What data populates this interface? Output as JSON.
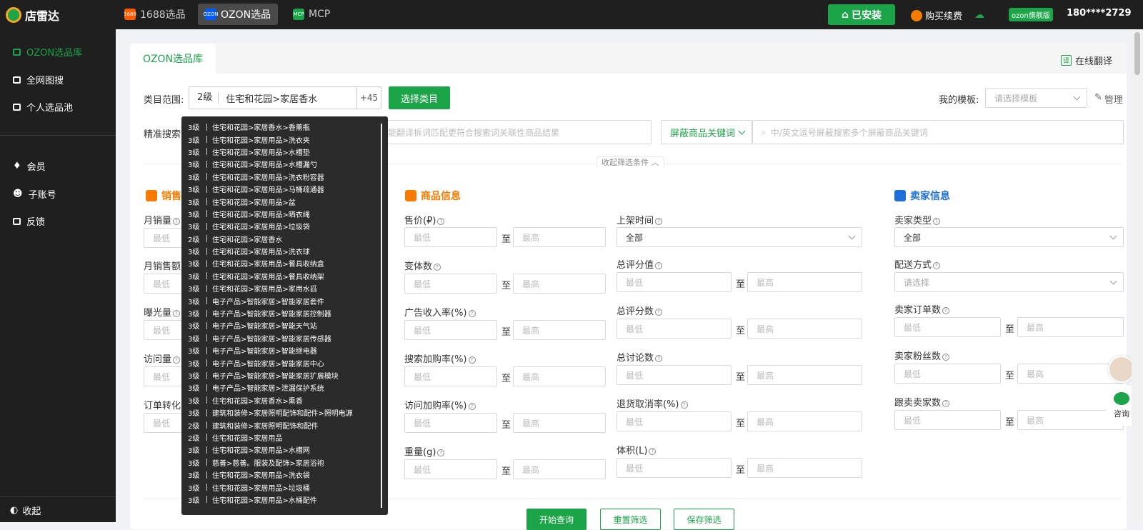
{
  "topbar": {
    "logo": "店雷达",
    "tabs": [
      {
        "label": "1688选品",
        "icon": "1688-icon",
        "color": "#ff5a00"
      },
      {
        "label": "OZON选品",
        "icon": "ozon-icon",
        "color": "#005bff"
      },
      {
        "label": "MCP",
        "icon": "mcp-icon",
        "color": "#1ba448"
      }
    ],
    "installed": "已安装",
    "renew": "购买续费",
    "vip": "ozon旗舰版",
    "phone": "180****2729"
  },
  "sidebar": {
    "items": [
      "OZON选品库",
      "全网图搜",
      "个人选品池"
    ],
    "items2": [
      "会员",
      "子账号",
      "反馈"
    ],
    "collapse": "收起"
  },
  "card": {
    "tab": "OZON选品库",
    "translate": "在线翻译",
    "category_label": "类目范围:",
    "category_level": "2级",
    "category_path": "住宅和花园>家居香水",
    "category_more": "+45",
    "select_category": "选择类目",
    "template_label": "我的模板:",
    "template_placeholder": "请选择模板",
    "manage": "管理",
    "precise_search": "精准搜索",
    "search_placeholder": "能翻译拆词匹配更符合搜索词关联性商品结果",
    "block_keyword": "屏蔽商品关键词",
    "block_placeholder": "中/英文逗号屏蔽搜索多个屏蔽商品关键词",
    "collapse_filter": "收起筛选条件"
  },
  "sections": {
    "sales": {
      "title": "销售",
      "fields": [
        "月销量",
        "月销售额",
        "曝光量",
        "访问量",
        "订单转化"
      ]
    },
    "product": {
      "title": "商品信息",
      "col1": [
        "售价(₽)",
        "变体数",
        "广告收入率(%)",
        "搜索加购率(%)",
        "访问加购率(%)",
        "重量(g)"
      ],
      "col2": [
        "上架时间",
        "总评分值",
        "总评分数",
        "总讨论数",
        "退货取消率(%)",
        "体积(L)"
      ],
      "listing_value": "全部"
    },
    "seller": {
      "title": "卖家信息",
      "fields": [
        "卖家类型",
        "配送方式",
        "卖家订单数",
        "卖家粉丝数",
        "跟卖卖家数"
      ],
      "type_value": "全部",
      "delivery_placeholder": "请选择"
    }
  },
  "placeholders": {
    "min": "最低",
    "max": "最高",
    "to": "至"
  },
  "buttons": {
    "start": "开始查询",
    "reset": "重置筛选",
    "save": "保存筛选"
  },
  "dropdown": [
    {
      "level": "3级",
      "path": "住宅和花园>家居香水>香薰瓶"
    },
    {
      "level": "3级",
      "path": "住宅和花园>家居用品>洗衣夹"
    },
    {
      "level": "3级",
      "path": "住宅和花园>家居用品>水槽垫"
    },
    {
      "level": "3级",
      "path": "住宅和花园>家居用品>水槽漏勺"
    },
    {
      "level": "3级",
      "path": "住宅和花园>家居用品>洗衣粉容器"
    },
    {
      "level": "3级",
      "path": "住宅和花园>家居用品>马桶疏通器"
    },
    {
      "level": "3级",
      "path": "住宅和花园>家居用品>盆"
    },
    {
      "level": "3级",
      "path": "住宅和花园>家居用品>晒衣绳"
    },
    {
      "level": "3级",
      "path": "住宅和花园>家居用品>垃圾袋"
    },
    {
      "level": "2级",
      "path": "住宅和花园>家居香水"
    },
    {
      "level": "3级",
      "path": "住宅和花园>家居用品>洗衣球"
    },
    {
      "level": "3级",
      "path": "住宅和花园>家居用品>餐具收纳盒"
    },
    {
      "level": "3级",
      "path": "住宅和花园>家居用品>餐具收纳架"
    },
    {
      "level": "3级",
      "path": "住宅和花园>家居用品>家用水舀"
    },
    {
      "level": "3级",
      "path": "电子产品>智能家居>智能家居套件"
    },
    {
      "level": "3级",
      "path": "电子产品>智能家居>智能家居控制器"
    },
    {
      "level": "3级",
      "path": "电子产品>智能家居>智能天气站"
    },
    {
      "level": "3级",
      "path": "电子产品>智能家居>智能家居传感器"
    },
    {
      "level": "3级",
      "path": "电子产品>智能家居>智能继电器"
    },
    {
      "level": "3级",
      "path": "电子产品>智能家居>智能家居中心"
    },
    {
      "level": "3级",
      "path": "电子产品>智能家居>智能家居扩展模块"
    },
    {
      "level": "3级",
      "path": "电子产品>智能家居>泄漏保护系统"
    },
    {
      "level": "3级",
      "path": "住宅和花园>家居香水>熏香"
    },
    {
      "level": "3级",
      "path": "建筑和装修>家居照明配饰和配件>照明电源"
    },
    {
      "level": "2级",
      "path": "建筑和装修>家居照明配饰和配件"
    },
    {
      "level": "2级",
      "path": "住宅和花园>家居用品"
    },
    {
      "level": "3级",
      "path": "住宅和花园>家居用品>水槽网"
    },
    {
      "level": "3级",
      "path": "慈善>慈善。服装及配饰>家居浴袍"
    },
    {
      "level": "3级",
      "path": "住宅和花园>家居用品>洗衣袋"
    },
    {
      "level": "3级",
      "path": "住宅和花园>家居用品>垃圾桶"
    },
    {
      "level": "3级",
      "path": "住宅和花园>家居用品>水桶配件"
    }
  ],
  "float": {
    "consult": "咨询"
  },
  "colors": {
    "accent": "#1ba448",
    "orange": "#f57c00",
    "blue": "#1e6fd9",
    "sidebar": "#1f1f1f"
  }
}
